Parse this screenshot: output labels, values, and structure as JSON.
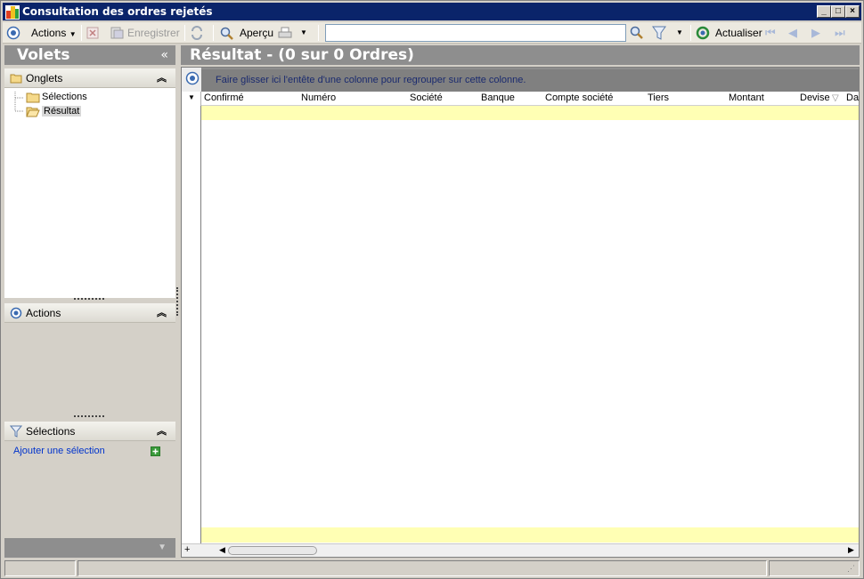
{
  "window": {
    "title": "Consultation des ordres rejetés"
  },
  "toolbar": {
    "actions_label": "Actions",
    "save_label": "Enregistrer",
    "preview_label": "Aperçu",
    "search_value": "",
    "refresh_label": "Actualiser"
  },
  "left_panel": {
    "title": "Volets",
    "tabs_section": {
      "title": "Onglets",
      "items": [
        {
          "label": "Sélections"
        },
        {
          "label": "Résultat"
        }
      ]
    },
    "actions_section": {
      "title": "Actions"
    },
    "selections_section": {
      "title": "Sélections",
      "add_link": "Ajouter une sélection"
    }
  },
  "result": {
    "title": "Résultat - (0 sur 0 Ordres)",
    "group_hint": "Faire glisser ici l'entête d'une colonne pour regrouper sur cette colonne.",
    "columns": [
      {
        "label": "Confirmé"
      },
      {
        "label": "Numéro"
      },
      {
        "label": "Société"
      },
      {
        "label": "Banque"
      },
      {
        "label": "Compte société"
      },
      {
        "label": "Tiers"
      },
      {
        "label": "Montant"
      },
      {
        "label": "Devise"
      },
      {
        "label": "Da"
      }
    ]
  },
  "colors": {
    "title_bar": "#0a246a",
    "panel_header": "#8e8e8e",
    "filter_row": "#ffffb4",
    "link": "#0033cc"
  }
}
